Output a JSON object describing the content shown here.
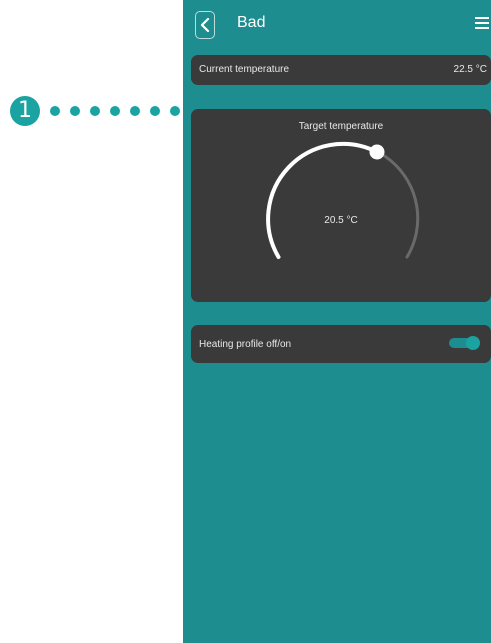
{
  "callout": {
    "number": "1",
    "color": "#1aa3a0"
  },
  "header": {
    "title": "Bad",
    "back_icon": "chevron-left-icon",
    "menu_icon": "hamburger-menu-icon"
  },
  "current_temperature": {
    "label": "Current temperature",
    "value": "22.5 °C"
  },
  "target_temperature": {
    "label": "Target temperature",
    "value": "20.5 °C"
  },
  "heating_profile": {
    "label": "Heating profile off/on",
    "enabled": true
  },
  "colors": {
    "background": "#1e8d90",
    "card": "#3a3a3a",
    "accent": "#1aa3a0",
    "text": "#e8e8e8"
  }
}
